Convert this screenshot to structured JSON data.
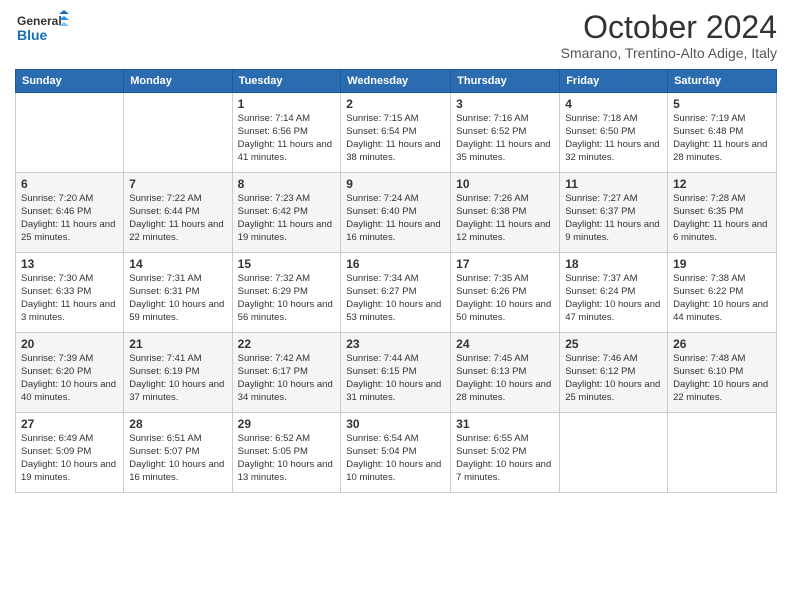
{
  "header": {
    "logo_line1": "General",
    "logo_line2": "Blue",
    "month": "October 2024",
    "location": "Smarano, Trentino-Alto Adige, Italy"
  },
  "days_of_week": [
    "Sunday",
    "Monday",
    "Tuesday",
    "Wednesday",
    "Thursday",
    "Friday",
    "Saturday"
  ],
  "weeks": [
    [
      {
        "day": "",
        "info": ""
      },
      {
        "day": "",
        "info": ""
      },
      {
        "day": "1",
        "info": "Sunrise: 7:14 AM\nSunset: 6:56 PM\nDaylight: 11 hours and 41 minutes."
      },
      {
        "day": "2",
        "info": "Sunrise: 7:15 AM\nSunset: 6:54 PM\nDaylight: 11 hours and 38 minutes."
      },
      {
        "day": "3",
        "info": "Sunrise: 7:16 AM\nSunset: 6:52 PM\nDaylight: 11 hours and 35 minutes."
      },
      {
        "day": "4",
        "info": "Sunrise: 7:18 AM\nSunset: 6:50 PM\nDaylight: 11 hours and 32 minutes."
      },
      {
        "day": "5",
        "info": "Sunrise: 7:19 AM\nSunset: 6:48 PM\nDaylight: 11 hours and 28 minutes."
      }
    ],
    [
      {
        "day": "6",
        "info": "Sunrise: 7:20 AM\nSunset: 6:46 PM\nDaylight: 11 hours and 25 minutes."
      },
      {
        "day": "7",
        "info": "Sunrise: 7:22 AM\nSunset: 6:44 PM\nDaylight: 11 hours and 22 minutes."
      },
      {
        "day": "8",
        "info": "Sunrise: 7:23 AM\nSunset: 6:42 PM\nDaylight: 11 hours and 19 minutes."
      },
      {
        "day": "9",
        "info": "Sunrise: 7:24 AM\nSunset: 6:40 PM\nDaylight: 11 hours and 16 minutes."
      },
      {
        "day": "10",
        "info": "Sunrise: 7:26 AM\nSunset: 6:38 PM\nDaylight: 11 hours and 12 minutes."
      },
      {
        "day": "11",
        "info": "Sunrise: 7:27 AM\nSunset: 6:37 PM\nDaylight: 11 hours and 9 minutes."
      },
      {
        "day": "12",
        "info": "Sunrise: 7:28 AM\nSunset: 6:35 PM\nDaylight: 11 hours and 6 minutes."
      }
    ],
    [
      {
        "day": "13",
        "info": "Sunrise: 7:30 AM\nSunset: 6:33 PM\nDaylight: 11 hours and 3 minutes."
      },
      {
        "day": "14",
        "info": "Sunrise: 7:31 AM\nSunset: 6:31 PM\nDaylight: 10 hours and 59 minutes."
      },
      {
        "day": "15",
        "info": "Sunrise: 7:32 AM\nSunset: 6:29 PM\nDaylight: 10 hours and 56 minutes."
      },
      {
        "day": "16",
        "info": "Sunrise: 7:34 AM\nSunset: 6:27 PM\nDaylight: 10 hours and 53 minutes."
      },
      {
        "day": "17",
        "info": "Sunrise: 7:35 AM\nSunset: 6:26 PM\nDaylight: 10 hours and 50 minutes."
      },
      {
        "day": "18",
        "info": "Sunrise: 7:37 AM\nSunset: 6:24 PM\nDaylight: 10 hours and 47 minutes."
      },
      {
        "day": "19",
        "info": "Sunrise: 7:38 AM\nSunset: 6:22 PM\nDaylight: 10 hours and 44 minutes."
      }
    ],
    [
      {
        "day": "20",
        "info": "Sunrise: 7:39 AM\nSunset: 6:20 PM\nDaylight: 10 hours and 40 minutes."
      },
      {
        "day": "21",
        "info": "Sunrise: 7:41 AM\nSunset: 6:19 PM\nDaylight: 10 hours and 37 minutes."
      },
      {
        "day": "22",
        "info": "Sunrise: 7:42 AM\nSunset: 6:17 PM\nDaylight: 10 hours and 34 minutes."
      },
      {
        "day": "23",
        "info": "Sunrise: 7:44 AM\nSunset: 6:15 PM\nDaylight: 10 hours and 31 minutes."
      },
      {
        "day": "24",
        "info": "Sunrise: 7:45 AM\nSunset: 6:13 PM\nDaylight: 10 hours and 28 minutes."
      },
      {
        "day": "25",
        "info": "Sunrise: 7:46 AM\nSunset: 6:12 PM\nDaylight: 10 hours and 25 minutes."
      },
      {
        "day": "26",
        "info": "Sunrise: 7:48 AM\nSunset: 6:10 PM\nDaylight: 10 hours and 22 minutes."
      }
    ],
    [
      {
        "day": "27",
        "info": "Sunrise: 6:49 AM\nSunset: 5:09 PM\nDaylight: 10 hours and 19 minutes."
      },
      {
        "day": "28",
        "info": "Sunrise: 6:51 AM\nSunset: 5:07 PM\nDaylight: 10 hours and 16 minutes."
      },
      {
        "day": "29",
        "info": "Sunrise: 6:52 AM\nSunset: 5:05 PM\nDaylight: 10 hours and 13 minutes."
      },
      {
        "day": "30",
        "info": "Sunrise: 6:54 AM\nSunset: 5:04 PM\nDaylight: 10 hours and 10 minutes."
      },
      {
        "day": "31",
        "info": "Sunrise: 6:55 AM\nSunset: 5:02 PM\nDaylight: 10 hours and 7 minutes."
      },
      {
        "day": "",
        "info": ""
      },
      {
        "day": "",
        "info": ""
      }
    ]
  ]
}
